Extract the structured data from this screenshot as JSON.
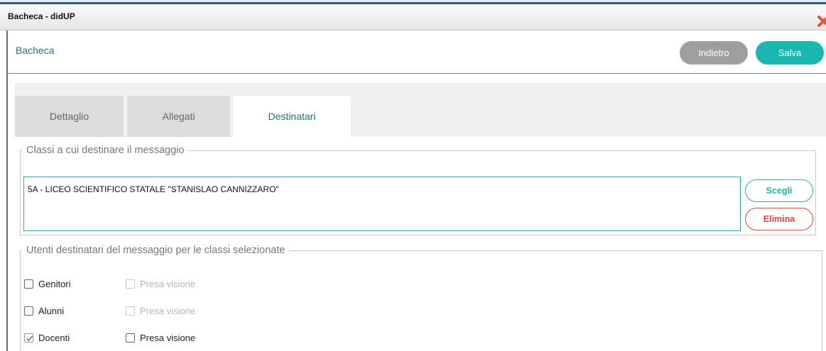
{
  "window": {
    "title": "Bacheca - didUP"
  },
  "header": {
    "title": "Bacheca",
    "back_label": "Indietro",
    "save_label": "Salva"
  },
  "tabs": [
    {
      "label": "Dettaglio",
      "active": false
    },
    {
      "label": "Allegati",
      "active": false
    },
    {
      "label": "Destinatari",
      "active": true
    }
  ],
  "classes_section": {
    "legend": "Classi a cui destinare il messaggio",
    "items": [
      "5A - LICEO SCIENTIFICO STATALE \"STANISLAO CANNIZZARO\""
    ],
    "choose_label": "Scegli",
    "delete_label": "Elimina"
  },
  "users_section": {
    "legend": "Utenti destinatari del messaggio per le classi selezionate",
    "rows": [
      {
        "label": "Genitori",
        "checked": false,
        "view_label": "Presa visione",
        "view_checked": false,
        "view_enabled": false
      },
      {
        "label": "Alunni",
        "checked": false,
        "view_label": "Presa visione",
        "view_checked": false,
        "view_enabled": false
      },
      {
        "label": "Docenti",
        "checked": true,
        "view_label": "Presa visione",
        "view_checked": false,
        "view_enabled": true
      }
    ]
  },
  "colors": {
    "accent": "#1ab7b0",
    "link_blue": "#1d6f9b",
    "danger": "#e04646",
    "back_grey": "#9e9e9e"
  }
}
